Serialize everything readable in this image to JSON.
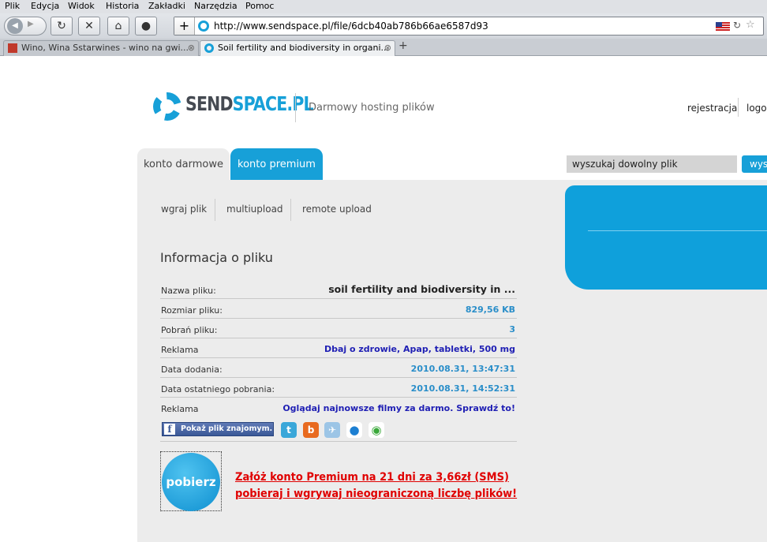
{
  "browser": {
    "menu": [
      "Plik",
      "Edycja",
      "Widok",
      "Historia",
      "Zakładki",
      "Narzędzia",
      "Pomoc"
    ],
    "url": "http://www.sendspace.pl/file/6dcb40ab786b66ae6587d93",
    "tabs": [
      {
        "label": "Wino, Wina Sstarwines - wino na gwi..."
      },
      {
        "label": "Soil fertility and biodiversity in organi..."
      }
    ]
  },
  "header": {
    "logo_main": "SEND",
    "logo_accent": "SPACE.PL",
    "tagline": "Darmowy hosting plików",
    "links": {
      "register": "rejestracja",
      "login": "logowanie"
    }
  },
  "account_tabs": {
    "free": "konto darmowe",
    "premium": "konto premium"
  },
  "search": {
    "placeholder": "wyszukaj dowolny plik",
    "button": "wyszukaj"
  },
  "subnav": [
    "wgraj plik",
    "multiupload",
    "remote upload"
  ],
  "file_info": {
    "title": "Informacja o pliku",
    "rows": [
      {
        "label": "Nazwa pliku:",
        "value": "soil fertility and biodiversity in ..."
      },
      {
        "label": "Rozmiar pliku:",
        "value": "829,56 KB"
      },
      {
        "label": "Pobrań pliku:",
        "value": "3"
      },
      {
        "label": "Reklama",
        "value": "Dbaj o zdrowie, Apap, tabletki, 500 mg"
      },
      {
        "label": "Data dodania:",
        "value": "2010.08.31, 13:47:31"
      },
      {
        "label": "Data ostatniego pobrania:",
        "value": "2010.08.31, 14:52:31"
      },
      {
        "label": "Reklama",
        "value": "Oglądaj najnowsze filmy za darmo. Sprawdź to!"
      }
    ]
  },
  "share": {
    "facebook_label": "Pokaż plik znajomym."
  },
  "download": {
    "button": "pobierz",
    "promo_line1": "Załóż konto Premium na 21 dni za 3,66zł (SMS)",
    "promo_line2": "pobieraj i wgrywaj nieograniczoną liczbę plików!"
  },
  "colors": {
    "brand": "#17a0d8",
    "promo": "#e00000",
    "link": "#1f1fb4"
  }
}
